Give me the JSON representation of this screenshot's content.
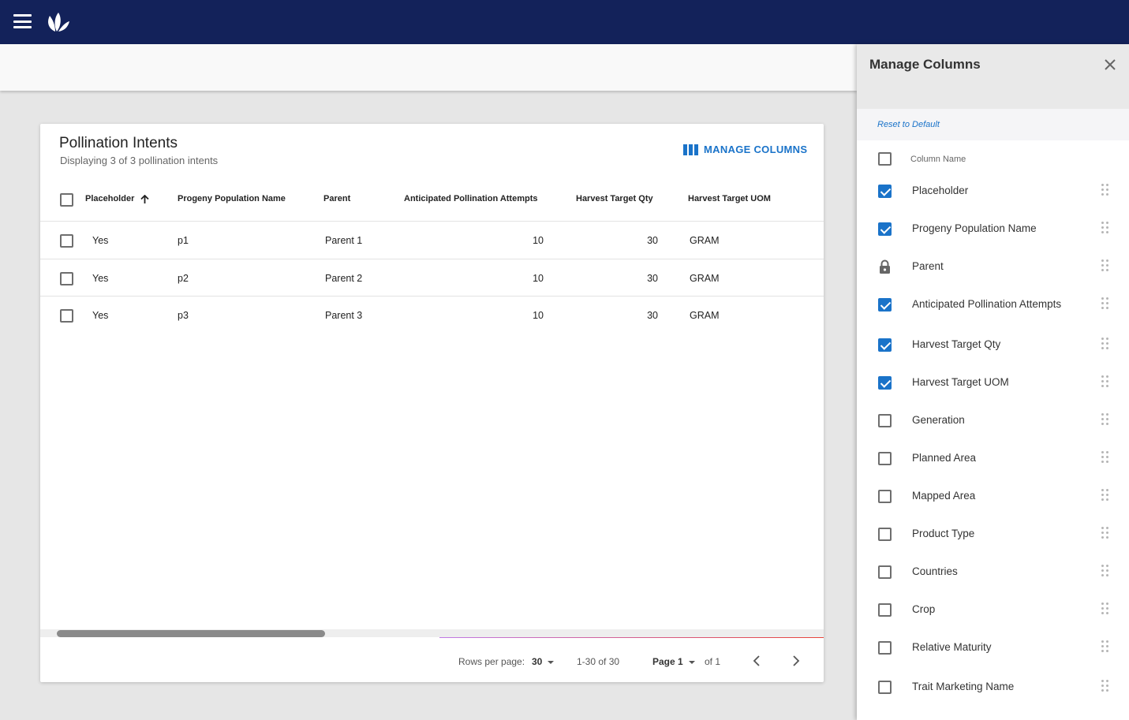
{
  "card": {
    "title": "Pollination Intents",
    "subtitle": "Displaying 3 of 3 pollination intents",
    "manage_columns_label": "MANAGE COLUMNS"
  },
  "table": {
    "headers": [
      "Placeholder",
      "Progeny Population Name",
      "Parent",
      "Anticipated Pollination Attempts",
      "Harvest Target Qty",
      "Harvest Target UOM"
    ],
    "rows": [
      [
        "Yes",
        "p1",
        "Parent 1",
        "10",
        "30",
        "GRAM"
      ],
      [
        "Yes",
        "p2",
        "Parent 2",
        "10",
        "30",
        "GRAM"
      ],
      [
        "Yes",
        "p3",
        "Parent 3",
        "10",
        "30",
        "GRAM"
      ]
    ]
  },
  "footer": {
    "rows_per_page_label": "Rows per page:",
    "rows_per_page_value": "30",
    "range": "1-30 of 30",
    "page_label": "Page 1",
    "of_label": "of 1"
  },
  "panel": {
    "title": "Manage Columns",
    "reset_label": "Reset to Default",
    "column_header": "Column Name",
    "columns": [
      {
        "label": "Placeholder",
        "state": "checked"
      },
      {
        "label": "Progeny Population Name",
        "state": "checked"
      },
      {
        "label": "Parent",
        "state": "locked"
      },
      {
        "label": "Anticipated Pollination Attempts",
        "state": "checked"
      },
      {
        "label": "Harvest Target Qty",
        "state": "checked"
      },
      {
        "label": "Harvest Target UOM",
        "state": "checked"
      },
      {
        "label": "Generation",
        "state": "unchecked"
      },
      {
        "label": "Planned Area",
        "state": "unchecked"
      },
      {
        "label": "Mapped Area",
        "state": "unchecked"
      },
      {
        "label": "Product Type",
        "state": "unchecked"
      },
      {
        "label": "Countries",
        "state": "unchecked"
      },
      {
        "label": "Crop",
        "state": "unchecked"
      },
      {
        "label": "Relative Maturity",
        "state": "unchecked"
      },
      {
        "label": "Trait Marketing Name",
        "state": "unchecked"
      }
    ]
  },
  "colors": {
    "topbar": "#13225a",
    "accent": "#1a73c9"
  },
  "icons": {
    "menu": "hamburger-icon",
    "logo": "leaf-logo-icon",
    "manage": "columns-icon",
    "sort": "arrow-up-icon",
    "close": "close-icon",
    "lock": "lock-icon",
    "drag": "drag-handle-icon"
  }
}
